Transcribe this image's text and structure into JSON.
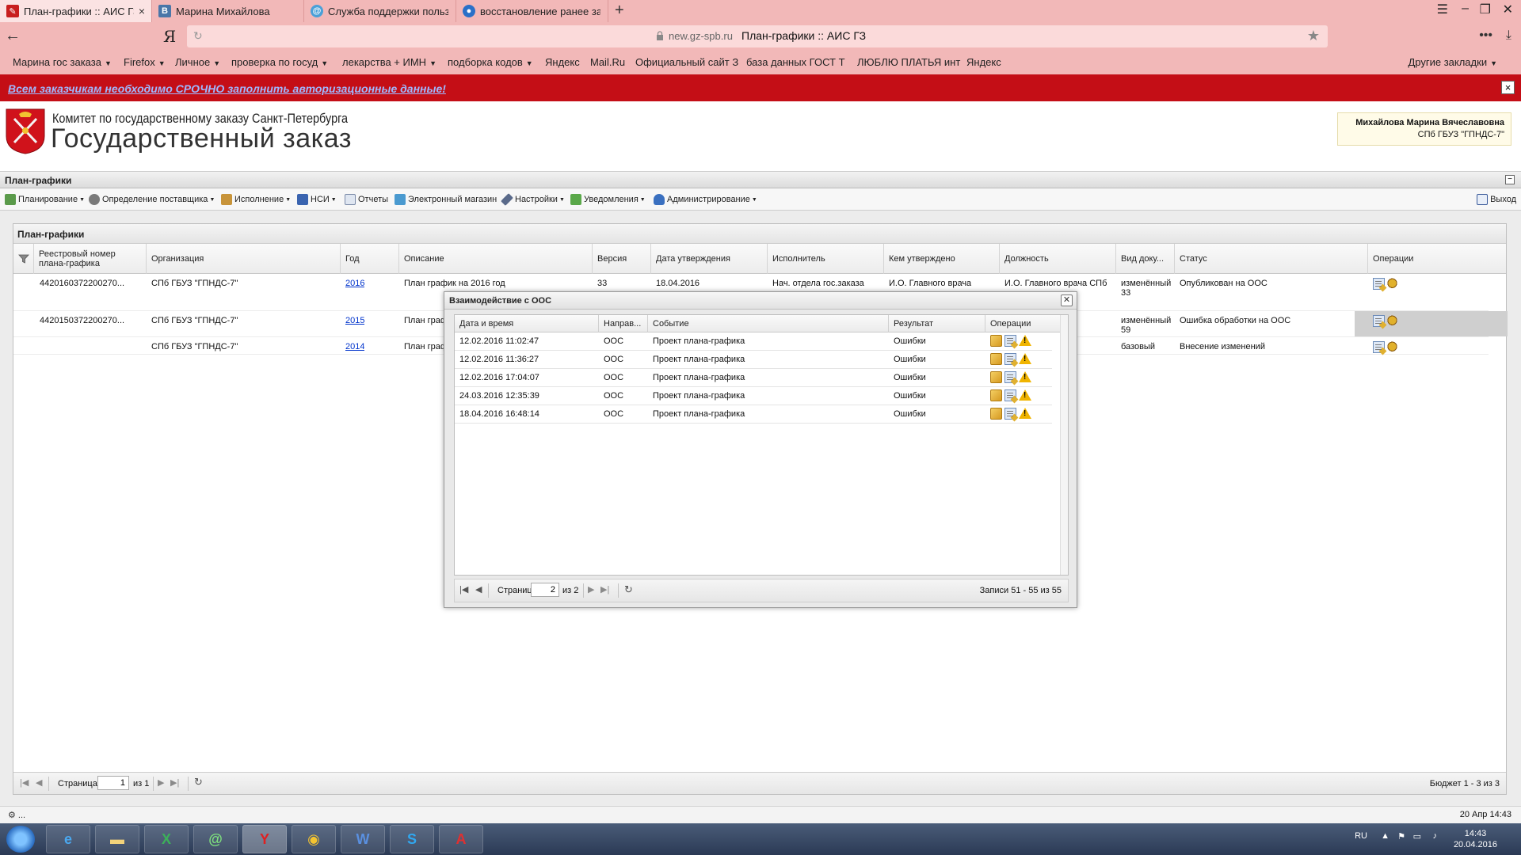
{
  "browser": {
    "tabs": [
      {
        "label": "План-графики :: АИС ГЗ",
        "active": true,
        "icon": "ais-icon"
      },
      {
        "label": "Марина Михайлова",
        "active": false,
        "icon": "vk-icon"
      },
      {
        "label": "Служба поддержки пользов",
        "active": false,
        "icon": "support-icon"
      },
      {
        "label": "восстановление ранее закрь",
        "active": false,
        "icon": "globe-icon"
      }
    ],
    "address": {
      "domain": "new.gz-spb.ru",
      "title": "План-графики :: АИС ГЗ",
      "search_logo": "Я"
    },
    "bookmarks": [
      {
        "label": "Марина гос заказа",
        "dropdown": true
      },
      {
        "label": "Firefox",
        "dropdown": true
      },
      {
        "label": "Личное",
        "dropdown": true
      },
      {
        "label": "проверка по госуд",
        "dropdown": true
      },
      {
        "label": "лекарства + ИМН",
        "dropdown": true
      },
      {
        "label": "подборка кодов",
        "dropdown": true
      },
      {
        "label": "Яндекс",
        "dropdown": false
      },
      {
        "label": "Mail.Ru",
        "dropdown": false
      },
      {
        "label": "Официальный сайт З",
        "dropdown": false
      },
      {
        "label": "база данных ГОСТ Т",
        "dropdown": false
      },
      {
        "label": "ЛЮБЛЮ ПЛАТЬЯ инт",
        "dropdown": false
      },
      {
        "label": "Яндекс",
        "dropdown": false
      }
    ],
    "other_bookmarks": "Другие закладки"
  },
  "alert": {
    "text": "Всем заказчикам необходимо СРОЧНО заполнить авторизационные данные!",
    "close": "×"
  },
  "header": {
    "org_name": "Комитет по государственному заказу Санкт-Петербурга",
    "system_name": "Государственный заказ",
    "user": {
      "name": "Михайлова Марина Вячеславовна",
      "org": "СПб ГБУЗ \"ГПНДС-7\""
    }
  },
  "section": {
    "title": "План-графики",
    "toggle": "−"
  },
  "menu": {
    "items": [
      {
        "label": "Планирование",
        "dropdown": true,
        "icon": "planning-icon"
      },
      {
        "label": "Определение поставщика",
        "dropdown": true,
        "icon": "supplier-icon"
      },
      {
        "label": "Исполнение",
        "dropdown": true,
        "icon": "execution-icon"
      },
      {
        "label": "НСИ",
        "dropdown": true,
        "icon": "nsi-icon"
      },
      {
        "label": "Отчеты",
        "dropdown": false,
        "icon": "reports-icon"
      },
      {
        "label": "Электронный магазин",
        "dropdown": false,
        "icon": "eshop-icon"
      },
      {
        "label": "Настройки",
        "dropdown": true,
        "icon": "settings-icon"
      },
      {
        "label": "Уведомления",
        "dropdown": true,
        "icon": "notifications-icon"
      },
      {
        "label": "Администрирование",
        "dropdown": true,
        "icon": "admin-icon"
      }
    ],
    "exit": "Выход"
  },
  "grid": {
    "title": "План-графики",
    "columns": [
      "Реестровый номер плана-графика",
      "Организация",
      "Год",
      "Описание",
      "Версия",
      "Дата утверждения",
      "Исполнитель",
      "Кем утверждено",
      "Должность",
      "Вид доку...",
      "Статус",
      "Операции"
    ],
    "rows": [
      {
        "reg": "4420160372200270...",
        "org": "СПб ГБУЗ \"ГПНДС-7\"",
        "year": "2016",
        "desc": "План график на 2016 год",
        "version": "33",
        "date": "18.04.2016",
        "executor": "Нач. отдела гос.заказа",
        "approved": "И.О. Главного врача",
        "position": "И.О. Главного врача СПб",
        "doc_type": "изменённый 33",
        "status": "Опубликован на ООС"
      },
      {
        "reg": "4420150372200270...",
        "org": "СПб ГБУЗ \"ГПНДС-7\"",
        "year": "2015",
        "desc": "План график",
        "version": "",
        "date": "",
        "executor": "",
        "approved": "",
        "position": "",
        "doc_type": "изменённый 59",
        "status": "Ошибка обработки на ООС"
      },
      {
        "reg": "",
        "org": "СПб ГБУЗ \"ГПНДС-7\"",
        "year": "2014",
        "desc": "План график",
        "version": "",
        "date": "",
        "executor": "",
        "approved": "",
        "position": "",
        "doc_type": "базовый",
        "status": "Внесение изменений"
      }
    ],
    "pager": {
      "page_label": "Страница",
      "page": "1",
      "of": "из 1",
      "summary": "Бюджет 1 - 3 из 3"
    }
  },
  "dialog": {
    "title": "Взаимодействие с ООС",
    "columns": [
      "Дата и время",
      "Направ...",
      "Событие",
      "Результат",
      "Операции"
    ],
    "rows": [
      {
        "datetime": "12.02.2016 11:02:47",
        "direction": "ООС",
        "event": "Проект плана-графика",
        "result": "Ошибки"
      },
      {
        "datetime": "12.02.2016 11:36:27",
        "direction": "ООС",
        "event": "Проект плана-графика",
        "result": "Ошибки"
      },
      {
        "datetime": "12.02.2016 17:04:07",
        "direction": "ООС",
        "event": "Проект плана-графика",
        "result": "Ошибки"
      },
      {
        "datetime": "24.03.2016 12:35:39",
        "direction": "ООС",
        "event": "Проект плана-графика",
        "result": "Ошибки"
      },
      {
        "datetime": "18.04.2016 16:48:14",
        "direction": "ООС",
        "event": "Проект плана-графика",
        "result": "Ошибки"
      }
    ],
    "pager": {
      "page_label": "Страница",
      "page": "2",
      "of": "из 2",
      "summary": "Записи 51 - 55 из 55"
    }
  },
  "status": {
    "left": "⚙ ...",
    "right": "20 Апр 14:43"
  },
  "taskbar": {
    "apps": [
      "ie-icon",
      "explorer-icon",
      "excel-icon",
      "mail-agent-icon",
      "yandex-browser-icon",
      "chrome-icon",
      "word-icon",
      "skype-icon",
      "acrobat-icon"
    ],
    "lang": "RU",
    "time": "14:43",
    "date": "20.04.2016"
  },
  "colors": {
    "alert": "#c40e16",
    "chrome": "#f2b8b8",
    "link": "#0033cc"
  }
}
